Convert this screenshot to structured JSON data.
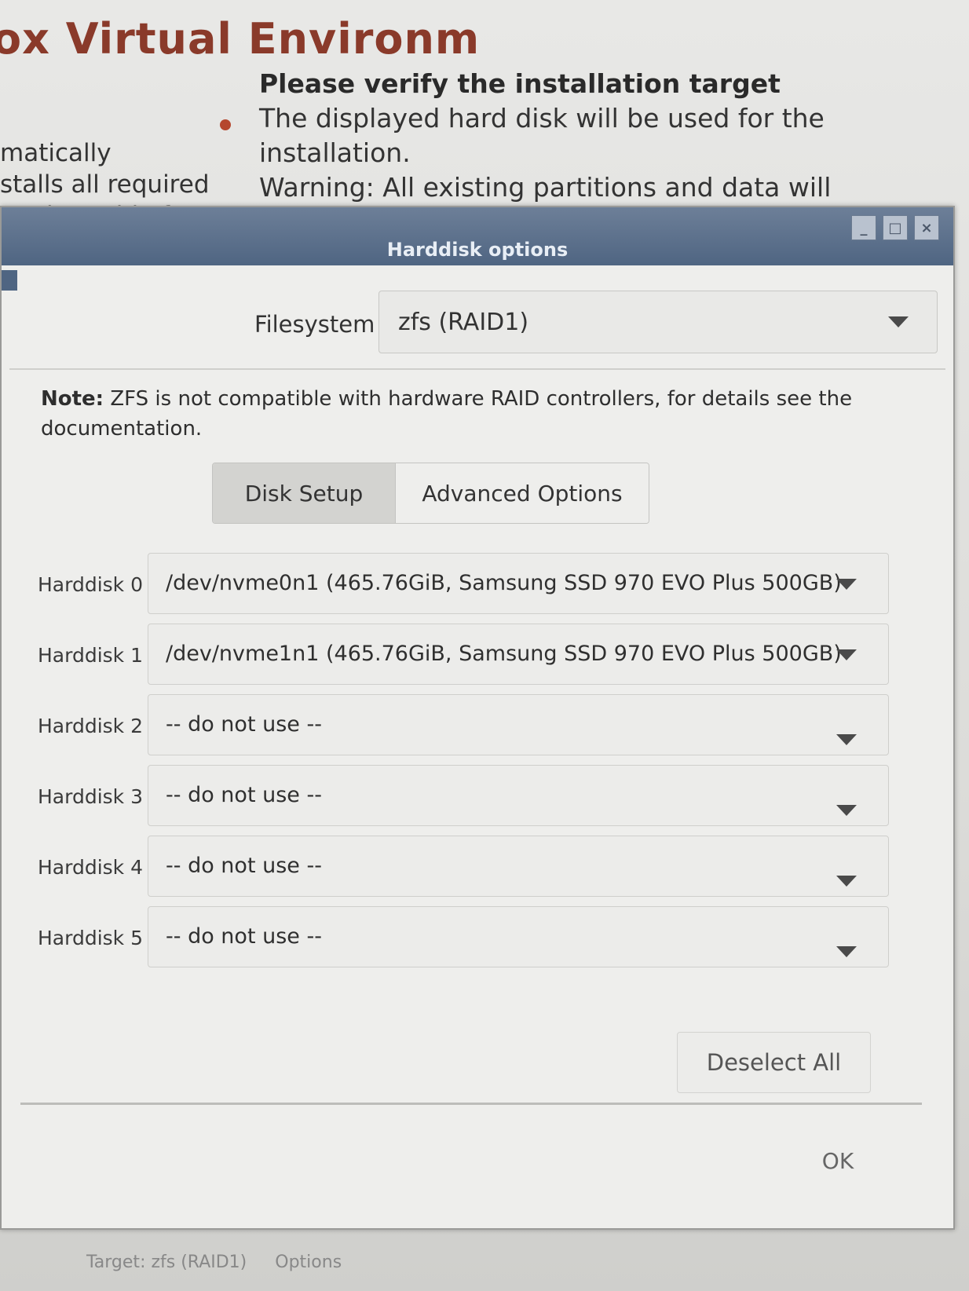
{
  "background": {
    "title": "ox Virtual Environm",
    "left_text": "matically\nstalls all required\nem bootable from\ntions and data",
    "heading": "Please verify the installation target",
    "line1": "The displayed hard disk will be used for the installation.",
    "line2": "Warning: All existing partitions and data will"
  },
  "dialog": {
    "title": "Harddisk options",
    "filesystem_label": "Filesystem",
    "filesystem_value": "zfs (RAID1)",
    "note_bold": "Note:",
    "note_text": " ZFS is not compatible with hardware RAID controllers, for details see the documentation.",
    "tabs": [
      {
        "label": "Disk Setup",
        "active": true
      },
      {
        "label": "Advanced Options",
        "active": false
      }
    ],
    "disks": [
      {
        "label": "Harddisk 0",
        "value": "/dev/nvme0n1 (465.76GiB, Samsung SSD 970 EVO Plus 500GB)"
      },
      {
        "label": "Harddisk 1",
        "value": "/dev/nvme1n1 (465.76GiB, Samsung SSD 970 EVO Plus 500GB)"
      },
      {
        "label": "Harddisk 2",
        "value": "-- do not use --"
      },
      {
        "label": "Harddisk 3",
        "value": "-- do not use --"
      },
      {
        "label": "Harddisk 4",
        "value": "-- do not use --"
      },
      {
        "label": "Harddisk 5",
        "value": "-- do not use --"
      }
    ],
    "deselect_all": "Deselect All",
    "ok": "OK"
  },
  "status": {
    "target": "Target: zfs (RAID1)",
    "options": "Options"
  },
  "colors": {
    "titlebar": "#4f6582",
    "brand_title": "#8a3a2a",
    "bullet": "#b5472e"
  }
}
